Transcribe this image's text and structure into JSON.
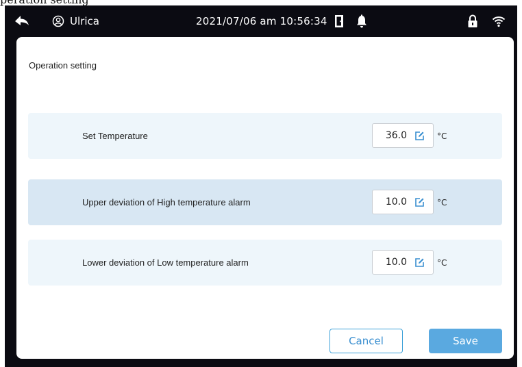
{
  "header_caption": "peration setting",
  "statusbar": {
    "back_icon": "back-arrow-icon",
    "user_icon": "user-badge-icon",
    "user_name": "Ulrica",
    "datetime": "2021/07/06 am 10:56:34",
    "door_icon": "door-icon",
    "bell_icon": "bell-icon",
    "lock_icon": "lock-icon",
    "wifi_icon": "wifi-icon"
  },
  "panel": {
    "title": "Operation setting",
    "rows": [
      {
        "label": "Set Temperature",
        "value": "36.0",
        "unit": "°C"
      },
      {
        "label": "Upper deviation of High temperature alarm",
        "value": "10.0",
        "unit": "°C"
      },
      {
        "label": "Lower deviation of Low temperature alarm",
        "value": "10.0",
        "unit": "°C"
      }
    ],
    "cancel_label": "Cancel",
    "save_label": "Save"
  },
  "colors": {
    "background_dark": "#0b0b12",
    "row_light": "#eef6fb",
    "row_highlight": "#d8e7f3",
    "accent": "#5aa9e0",
    "edit_icon": "#3a8fd0"
  }
}
